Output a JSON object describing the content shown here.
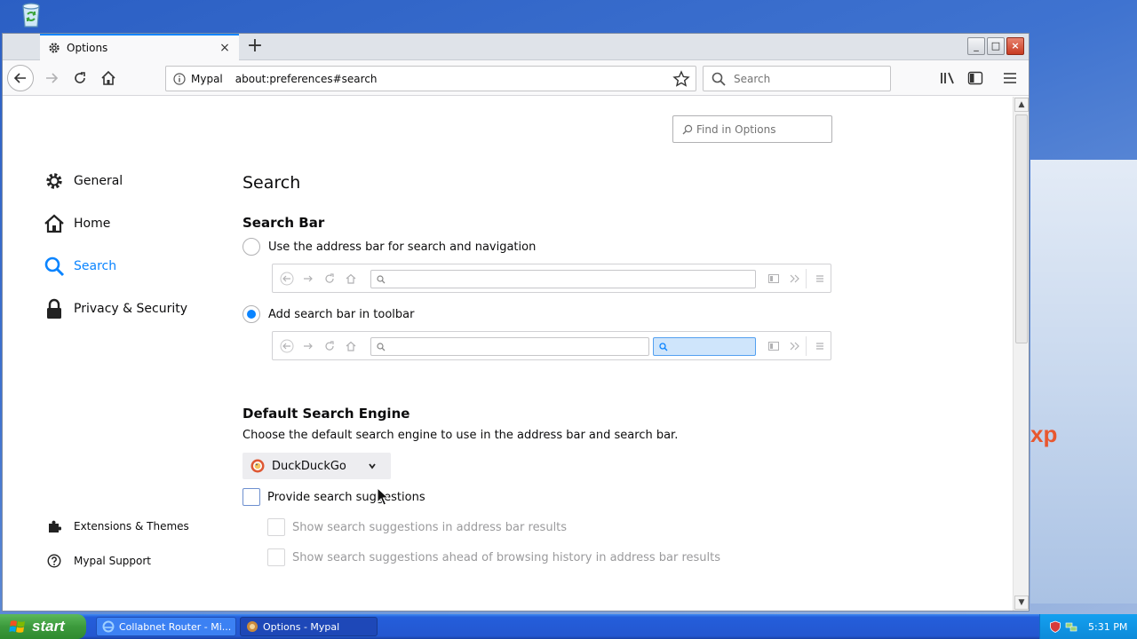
{
  "browser": {
    "tab": {
      "title": "Options",
      "close": "×"
    },
    "new_tab": "+",
    "window_controls": {
      "minimize": "_",
      "maximize": "□",
      "close": "×"
    },
    "urlbar": {
      "identity": "Mypal",
      "url": "about:preferences#search"
    },
    "searchbar": {
      "placeholder": "Search"
    }
  },
  "options": {
    "find_placeholder": "Find in Options",
    "categories": [
      {
        "label": "General",
        "icon": "gear-icon"
      },
      {
        "label": "Home",
        "icon": "home-icon"
      },
      {
        "label": "Search",
        "icon": "search-icon",
        "selected": true
      },
      {
        "label": "Privacy & Security",
        "icon": "lock-icon"
      }
    ],
    "footer": [
      {
        "label": "Extensions & Themes",
        "icon": "puzzle-icon"
      },
      {
        "label": "Mypal Support",
        "icon": "help-icon"
      }
    ],
    "page_title": "Search",
    "search_bar": {
      "title": "Search Bar",
      "option_address": "Use the address bar for search and navigation",
      "option_toolbar": "Add search bar in toolbar",
      "selected": "toolbar"
    },
    "default_engine": {
      "title": "Default Search Engine",
      "description": "Choose the default search engine to use in the address bar and search bar.",
      "engine": "DuckDuckGo",
      "provide_suggestions": "Provide search suggestions",
      "suggest_address_bar": "Show search suggestions in address bar results",
      "suggest_ahead": "Show search suggestions ahead of browsing history in address bar results"
    }
  },
  "taskbar": {
    "start": "start",
    "tasks": [
      {
        "label": "Collabnet Router - Mi..."
      },
      {
        "label": "Options - Mypal"
      }
    ],
    "clock": "5:31 PM"
  },
  "desktop": {
    "wallpaper_text": "xp"
  },
  "colors": {
    "accent": "#0a84ff",
    "taskbar": "#245edb",
    "start_green": "#3c9a3c"
  }
}
